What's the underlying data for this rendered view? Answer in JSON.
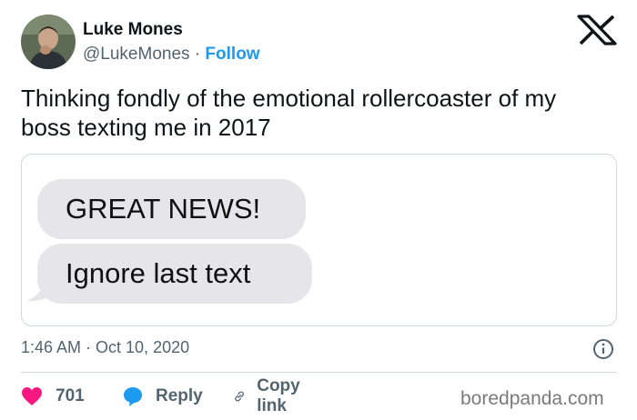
{
  "author": {
    "name": "Luke Mones",
    "handle": "@LukeMones",
    "separator": " · ",
    "follow_label": "Follow"
  },
  "tweet": {
    "text": "Thinking fondly of the emotional rollercoaster of my boss texting me in 2017",
    "timestamp": "1:46 AM · Oct 10, 2020"
  },
  "media": {
    "messages": [
      "GREAT NEWS!",
      "Ignore last text"
    ]
  },
  "actions": {
    "likes_count": "701",
    "reply_label": "Reply",
    "copy_link_label": "Copy link"
  },
  "watermark": "boredpanda.com",
  "colors": {
    "link_blue": "#1d9bf0",
    "heart_red": "#f91880",
    "bubble_gray": "#e5e5ea"
  }
}
